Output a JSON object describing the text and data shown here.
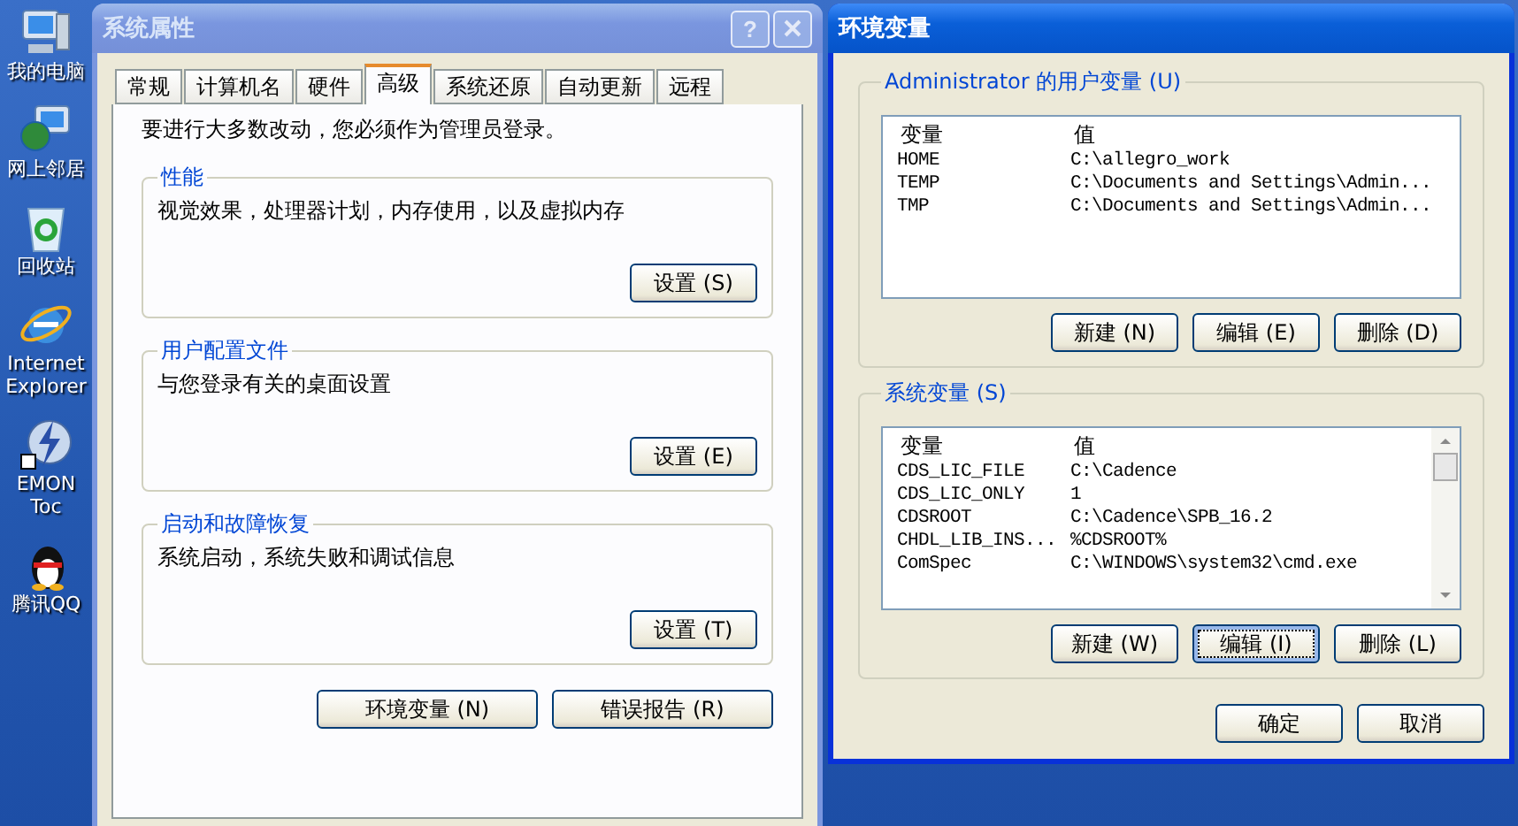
{
  "desktop_icons": [
    {
      "kind": "computer",
      "label": "我的电脑"
    },
    {
      "kind": "network",
      "label": "网上邻居"
    },
    {
      "kind": "recycle",
      "label": "回收站"
    },
    {
      "kind": "browser",
      "label": "Internet Explorer"
    },
    {
      "kind": "bolt",
      "label": "EMON Toc"
    },
    {
      "kind": "penguin",
      "label": "腾讯QQ"
    }
  ],
  "system_properties": {
    "title": "系统属性",
    "active": false,
    "help_button": "?",
    "tabs": [
      {
        "label": "常规",
        "selected": false
      },
      {
        "label": "计算机名",
        "selected": false
      },
      {
        "label": "硬件",
        "selected": false
      },
      {
        "label": "高级",
        "selected": true
      },
      {
        "label": "系统还原",
        "selected": false
      },
      {
        "label": "自动更新",
        "selected": false
      },
      {
        "label": "远程",
        "selected": false
      }
    ],
    "notice": "要进行大多数改动，您必须作为管理员登录。",
    "groups": [
      {
        "title": "性能",
        "description": "视觉效果，处理器计划，内存使用，以及虚拟内存",
        "button": "设置 (S)"
      },
      {
        "title": "用户配置文件",
        "description": "与您登录有关的桌面设置",
        "button": "设置 (E)"
      },
      {
        "title": "启动和故障恢复",
        "description": "系统启动，系统失败和调试信息",
        "button": "设置 (T)"
      }
    ],
    "buttons": [
      "环境变量 (N)",
      "错误报告 (R)"
    ]
  },
  "environment_variables": {
    "title": "环境变量",
    "active": true,
    "lists": [
      {
        "title": "Administrator 的用户变量 (U)",
        "columns": [
          "变量",
          "值"
        ],
        "scrollbar": false,
        "rows": [
          [
            "HOME",
            "C:\\allegro_work"
          ],
          [
            "TEMP",
            "C:\\Documents and Settings\\Admin..."
          ],
          [
            "TMP",
            "C:\\Documents and Settings\\Admin..."
          ]
        ],
        "buttons": [
          {
            "label": "新建 (N)",
            "focused": false
          },
          {
            "label": "编辑 (E)",
            "focused": false
          },
          {
            "label": "删除 (D)",
            "focused": false
          }
        ]
      },
      {
        "title": "系统变量 (S)",
        "columns": [
          "变量",
          "值"
        ],
        "scrollbar": true,
        "rows": [
          [
            "CDS_LIC_FILE",
            "C:\\Cadence"
          ],
          [
            "CDS_LIC_ONLY",
            "1"
          ],
          [
            "CDSROOT",
            "C:\\Cadence\\SPB_16.2"
          ],
          [
            "CHDL_LIB_INS...",
            "%CDSROOT%"
          ],
          [
            "ComSpec",
            "C:\\WINDOWS\\system32\\cmd.exe"
          ]
        ],
        "buttons": [
          {
            "label": "新建 (W)",
            "focused": false
          },
          {
            "label": "编辑 (I)",
            "focused": true
          },
          {
            "label": "删除 (L)",
            "focused": false
          }
        ]
      }
    ],
    "buttons": [
      "确定",
      "取消"
    ]
  }
}
